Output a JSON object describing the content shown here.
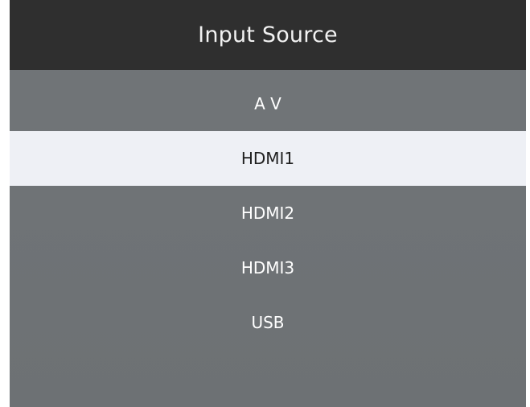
{
  "header": {
    "title": "Input Source"
  },
  "menu": {
    "items": [
      {
        "label": "A V",
        "selected": false
      },
      {
        "label": "HDMI1",
        "selected": true
      },
      {
        "label": "HDMI2",
        "selected": false
      },
      {
        "label": "HDMI3",
        "selected": false
      },
      {
        "label": "USB",
        "selected": false
      }
    ]
  },
  "colors": {
    "header_bg": "#2f2f2f",
    "panel_bg": "#717578",
    "selected_bg": "#eef0f5",
    "text_light": "#ffffff",
    "text_dark": "#1f1f1f"
  }
}
